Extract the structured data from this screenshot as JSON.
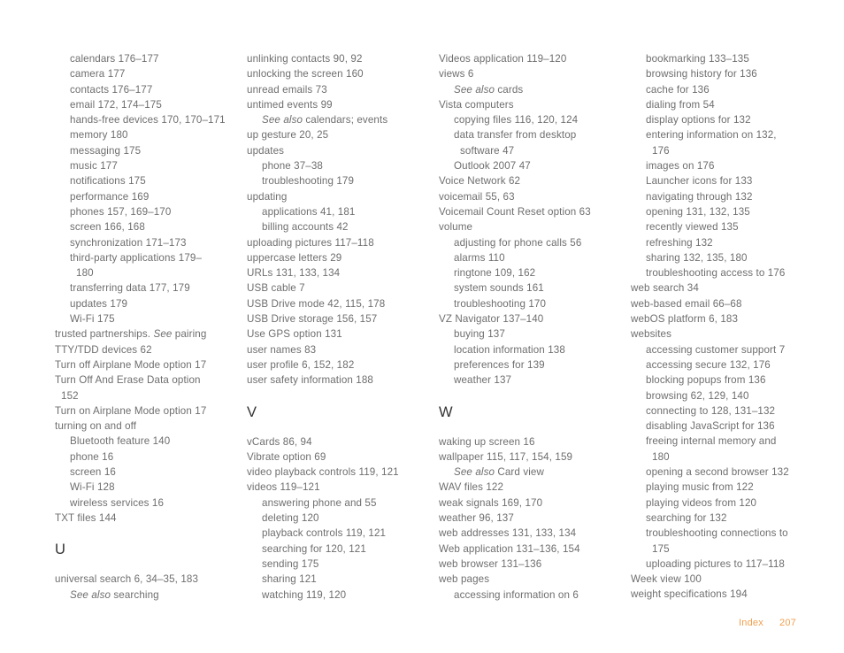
{
  "page": {
    "type": "book-index",
    "footer": {
      "label": "Index",
      "page_number": "207"
    },
    "colors": {
      "body_text": "#6e6e6e",
      "heading_text": "#333333",
      "folio_accent": "#f0a050",
      "background": "#ffffff"
    }
  },
  "columns": [
    {
      "id": "column-1",
      "blocks": [
        {
          "kind": "entry",
          "level": 1,
          "text": "calendars 176–177"
        },
        {
          "kind": "entry",
          "level": 1,
          "text": "camera 177"
        },
        {
          "kind": "entry",
          "level": 1,
          "text": "contacts 176–177"
        },
        {
          "kind": "entry",
          "level": 1,
          "text": "email 172, 174–175"
        },
        {
          "kind": "entry",
          "level": 1,
          "text": "hands-free devices 170, 170–171"
        },
        {
          "kind": "entry",
          "level": 1,
          "text": "memory 180"
        },
        {
          "kind": "entry",
          "level": 1,
          "text": "messaging 175"
        },
        {
          "kind": "entry",
          "level": 1,
          "text": "music 177"
        },
        {
          "kind": "entry",
          "level": 1,
          "text": "notifications 175"
        },
        {
          "kind": "entry",
          "level": 1,
          "text": "performance 169"
        },
        {
          "kind": "entry",
          "level": 1,
          "text": "phones 157, 169–170"
        },
        {
          "kind": "entry",
          "level": 1,
          "text": "screen 166, 168"
        },
        {
          "kind": "entry",
          "level": 1,
          "text": "synchronization 171–173"
        },
        {
          "kind": "entry",
          "level": 1,
          "text": "third-party applications 179–"
        },
        {
          "kind": "wrap",
          "level": 2,
          "text": "180"
        },
        {
          "kind": "entry",
          "level": 1,
          "text": "transferring data 177, 179"
        },
        {
          "kind": "entry",
          "level": 1,
          "text": "updates 179"
        },
        {
          "kind": "entry",
          "level": 1,
          "text": "Wi-Fi 175"
        },
        {
          "kind": "entry-italic-see",
          "level": 0,
          "text": "trusted partnerships. ",
          "italic": "See",
          "tail": " pairing"
        },
        {
          "kind": "entry",
          "level": 0,
          "text": "TTY/TDD devices 62"
        },
        {
          "kind": "entry",
          "level": 0,
          "text": "Turn off Airplane Mode option 17"
        },
        {
          "kind": "entry",
          "level": 0,
          "text": "Turn Off And Erase Data option"
        },
        {
          "kind": "wrap",
          "level": 0,
          "wrapIndent": true,
          "text": "152"
        },
        {
          "kind": "entry",
          "level": 0,
          "text": "Turn on Airplane Mode option 17"
        },
        {
          "kind": "entry",
          "level": 0,
          "text": "turning on and off"
        },
        {
          "kind": "entry",
          "level": 1,
          "text": "Bluetooth feature 140"
        },
        {
          "kind": "entry",
          "level": 1,
          "text": "phone 16"
        },
        {
          "kind": "entry",
          "level": 1,
          "text": "screen 16"
        },
        {
          "kind": "entry",
          "level": 1,
          "text": "Wi-Fi 128"
        },
        {
          "kind": "entry",
          "level": 1,
          "text": "wireless services 16"
        },
        {
          "kind": "entry",
          "level": 0,
          "text": "TXT files 144"
        },
        {
          "kind": "gap-before-head"
        },
        {
          "kind": "head",
          "text": "U"
        },
        {
          "kind": "gap-after-head"
        },
        {
          "kind": "entry",
          "level": 0,
          "text": "universal search 6, 34–35, 183"
        },
        {
          "kind": "entry-italic-see",
          "level": 1,
          "text": "",
          "italic": "See also",
          "tail": " searching"
        }
      ]
    },
    {
      "id": "column-2",
      "blocks": [
        {
          "kind": "entry",
          "level": 0,
          "text": "unlinking contacts 90, 92"
        },
        {
          "kind": "entry",
          "level": 0,
          "text": "unlocking the screen 160"
        },
        {
          "kind": "entry",
          "level": 0,
          "text": "unread emails 73"
        },
        {
          "kind": "entry",
          "level": 0,
          "text": "untimed events 99"
        },
        {
          "kind": "entry-italic-see",
          "level": 1,
          "text": "",
          "italic": "See also",
          "tail": " calendars; events"
        },
        {
          "kind": "entry",
          "level": 0,
          "text": "up gesture 20, 25"
        },
        {
          "kind": "entry",
          "level": 0,
          "text": "updates"
        },
        {
          "kind": "entry",
          "level": 1,
          "text": "phone 37–38"
        },
        {
          "kind": "entry",
          "level": 1,
          "text": "troubleshooting 179"
        },
        {
          "kind": "entry",
          "level": 0,
          "text": "updating"
        },
        {
          "kind": "entry",
          "level": 1,
          "text": "applications 41, 181"
        },
        {
          "kind": "entry",
          "level": 1,
          "text": "billing accounts 42"
        },
        {
          "kind": "entry",
          "level": 0,
          "text": "uploading pictures 117–118"
        },
        {
          "kind": "entry",
          "level": 0,
          "text": "uppercase letters 29"
        },
        {
          "kind": "entry",
          "level": 0,
          "text": "URLs 131, 133, 134"
        },
        {
          "kind": "entry",
          "level": 0,
          "text": "USB cable 7"
        },
        {
          "kind": "entry",
          "level": 0,
          "text": "USB Drive mode 42, 115, 178"
        },
        {
          "kind": "entry",
          "level": 0,
          "text": "USB Drive storage 156, 157"
        },
        {
          "kind": "entry",
          "level": 0,
          "text": "Use GPS option 131"
        },
        {
          "kind": "entry",
          "level": 0,
          "text": "user names 83"
        },
        {
          "kind": "entry",
          "level": 0,
          "text": "user profile 6, 152, 182"
        },
        {
          "kind": "entry",
          "level": 0,
          "text": "user safety information 188"
        },
        {
          "kind": "gap-before-head"
        },
        {
          "kind": "head",
          "text": "V"
        },
        {
          "kind": "gap-after-head"
        },
        {
          "kind": "entry",
          "level": 0,
          "text": "vCards 86, 94"
        },
        {
          "kind": "entry",
          "level": 0,
          "text": "Vibrate option 69"
        },
        {
          "kind": "entry",
          "level": 0,
          "text": "video playback controls 119, 121"
        },
        {
          "kind": "entry",
          "level": 0,
          "text": "videos 119–121"
        },
        {
          "kind": "entry",
          "level": 1,
          "text": "answering phone and 55"
        },
        {
          "kind": "entry",
          "level": 1,
          "text": "deleting 120"
        },
        {
          "kind": "entry",
          "level": 1,
          "text": "playback controls 119, 121"
        },
        {
          "kind": "entry",
          "level": 1,
          "text": "searching for 120, 121"
        },
        {
          "kind": "entry",
          "level": 1,
          "text": "sending 175"
        },
        {
          "kind": "entry",
          "level": 1,
          "text": "sharing 121"
        },
        {
          "kind": "entry",
          "level": 1,
          "text": "watching 119, 120"
        }
      ]
    },
    {
      "id": "column-3",
      "blocks": [
        {
          "kind": "entry",
          "level": 0,
          "text": "Videos application 119–120"
        },
        {
          "kind": "entry",
          "level": 0,
          "text": "views 6"
        },
        {
          "kind": "entry-italic-see",
          "level": 1,
          "text": "",
          "italic": "See also",
          "tail": " cards"
        },
        {
          "kind": "entry",
          "level": 0,
          "text": "Vista computers"
        },
        {
          "kind": "entry",
          "level": 1,
          "text": "copying files 116, 120, 124"
        },
        {
          "kind": "entry",
          "level": 1,
          "text": "data transfer from desktop"
        },
        {
          "kind": "wrap",
          "level": 2,
          "text": "software 47"
        },
        {
          "kind": "entry",
          "level": 1,
          "text": "Outlook 2007 47"
        },
        {
          "kind": "entry",
          "level": 0,
          "text": "Voice Network 62"
        },
        {
          "kind": "entry",
          "level": 0,
          "text": "voicemail 55, 63"
        },
        {
          "kind": "entry",
          "level": 0,
          "text": "Voicemail Count Reset option 63"
        },
        {
          "kind": "entry",
          "level": 0,
          "text": "volume"
        },
        {
          "kind": "entry",
          "level": 1,
          "text": "adjusting for phone calls 56"
        },
        {
          "kind": "entry",
          "level": 1,
          "text": "alarms 110"
        },
        {
          "kind": "entry",
          "level": 1,
          "text": "ringtone 109, 162"
        },
        {
          "kind": "entry",
          "level": 1,
          "text": "system sounds 161"
        },
        {
          "kind": "entry",
          "level": 1,
          "text": "troubleshooting 170"
        },
        {
          "kind": "entry",
          "level": 0,
          "text": "VZ Navigator 137–140"
        },
        {
          "kind": "entry",
          "level": 1,
          "text": "buying 137"
        },
        {
          "kind": "entry",
          "level": 1,
          "text": "location information 138"
        },
        {
          "kind": "entry",
          "level": 1,
          "text": "preferences for 139"
        },
        {
          "kind": "entry",
          "level": 1,
          "text": "weather 137"
        },
        {
          "kind": "gap-before-head"
        },
        {
          "kind": "head",
          "text": "W"
        },
        {
          "kind": "gap-after-head"
        },
        {
          "kind": "entry",
          "level": 0,
          "text": "waking up screen 16"
        },
        {
          "kind": "entry",
          "level": 0,
          "text": "wallpaper 115, 117, 154, 159"
        },
        {
          "kind": "entry-italic-see",
          "level": 1,
          "text": "",
          "italic": "See also",
          "tail": " Card view"
        },
        {
          "kind": "entry",
          "level": 0,
          "text": "WAV files 122"
        },
        {
          "kind": "entry",
          "level": 0,
          "text": "weak signals 169, 170"
        },
        {
          "kind": "entry",
          "level": 0,
          "text": "weather 96, 137"
        },
        {
          "kind": "entry",
          "level": 0,
          "text": "web addresses 131, 133, 134"
        },
        {
          "kind": "entry",
          "level": 0,
          "text": "Web application 131–136, 154"
        },
        {
          "kind": "entry",
          "level": 0,
          "text": "web browser 131–136"
        },
        {
          "kind": "entry",
          "level": 0,
          "text": "web pages"
        },
        {
          "kind": "entry",
          "level": 1,
          "text": "accessing information on 6"
        }
      ]
    },
    {
      "id": "column-4",
      "blocks": [
        {
          "kind": "entry",
          "level": 1,
          "text": "bookmarking 133–135"
        },
        {
          "kind": "entry",
          "level": 1,
          "text": "browsing history for 136"
        },
        {
          "kind": "entry",
          "level": 1,
          "text": "cache for 136"
        },
        {
          "kind": "entry",
          "level": 1,
          "text": "dialing from 54"
        },
        {
          "kind": "entry",
          "level": 1,
          "text": "display options for 132"
        },
        {
          "kind": "entry",
          "level": 1,
          "text": "entering information on 132,"
        },
        {
          "kind": "wrap",
          "level": 2,
          "text": "176"
        },
        {
          "kind": "entry",
          "level": 1,
          "text": "images on 176"
        },
        {
          "kind": "entry",
          "level": 1,
          "text": "Launcher icons for 133"
        },
        {
          "kind": "entry",
          "level": 1,
          "text": "navigating through 132"
        },
        {
          "kind": "entry",
          "level": 1,
          "text": "opening 131, 132, 135"
        },
        {
          "kind": "entry",
          "level": 1,
          "text": "recently viewed 135"
        },
        {
          "kind": "entry",
          "level": 1,
          "text": "refreshing 132"
        },
        {
          "kind": "entry",
          "level": 1,
          "text": "sharing 132, 135, 180"
        },
        {
          "kind": "entry",
          "level": 1,
          "text": "troubleshooting access to 176"
        },
        {
          "kind": "entry",
          "level": 0,
          "text": "web search 34"
        },
        {
          "kind": "entry",
          "level": 0,
          "text": "web-based email 66–68"
        },
        {
          "kind": "entry",
          "level": 0,
          "text": "webOS platform 6, 183"
        },
        {
          "kind": "entry",
          "level": 0,
          "text": "websites"
        },
        {
          "kind": "entry",
          "level": 1,
          "text": "accessing customer support 7"
        },
        {
          "kind": "entry",
          "level": 1,
          "text": "accessing secure 132, 176"
        },
        {
          "kind": "entry",
          "level": 1,
          "text": "blocking popups from 136"
        },
        {
          "kind": "entry",
          "level": 1,
          "text": "browsing 62, 129, 140"
        },
        {
          "kind": "entry",
          "level": 1,
          "text": "connecting to 128, 131–132"
        },
        {
          "kind": "entry",
          "level": 1,
          "text": "disabling JavaScript for 136"
        },
        {
          "kind": "entry",
          "level": 1,
          "text": "freeing internal memory and"
        },
        {
          "kind": "wrap",
          "level": 2,
          "text": "180"
        },
        {
          "kind": "entry",
          "level": 1,
          "text": "opening a second browser 132"
        },
        {
          "kind": "entry",
          "level": 1,
          "text": "playing music from 122"
        },
        {
          "kind": "entry",
          "level": 1,
          "text": "playing videos from 120"
        },
        {
          "kind": "entry",
          "level": 1,
          "text": "searching for 132"
        },
        {
          "kind": "entry",
          "level": 1,
          "text": "troubleshooting connections to"
        },
        {
          "kind": "wrap",
          "level": 2,
          "text": "175"
        },
        {
          "kind": "entry",
          "level": 1,
          "text": "uploading pictures to 117–118"
        },
        {
          "kind": "entry",
          "level": 0,
          "text": "Week view 100"
        },
        {
          "kind": "entry",
          "level": 0,
          "text": "weight specifications 194"
        }
      ]
    }
  ]
}
